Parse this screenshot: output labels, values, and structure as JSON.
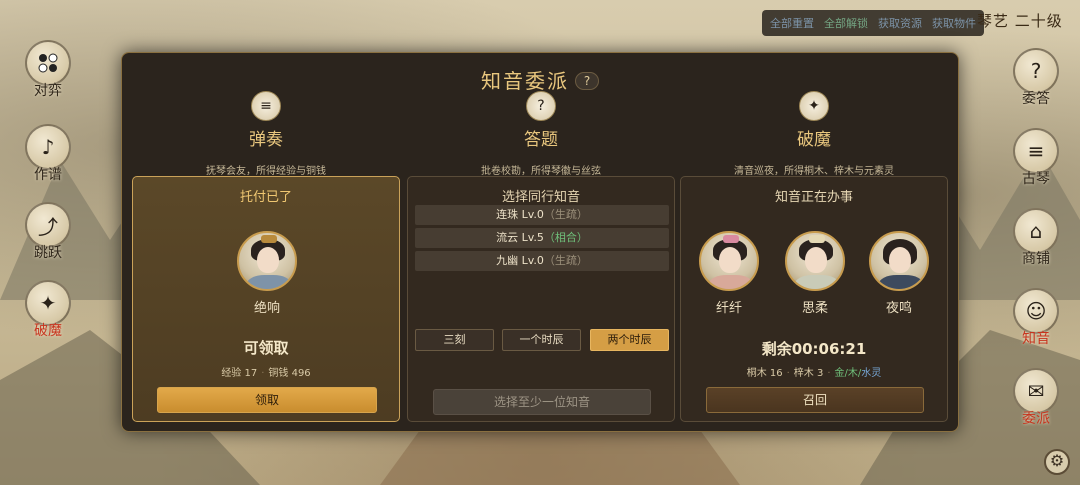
{
  "debug_bar": {
    "reset_all": "全部重置",
    "unlock_all": "全部解锁",
    "get_resources": "获取资源",
    "get_items": "获取物件"
  },
  "skill_level": "琴艺 二十级",
  "left_nav": [
    {
      "label": "对弈",
      "icon": "go-board-icon"
    },
    {
      "label": "作谱",
      "icon": "score-icon"
    },
    {
      "label": "跳跃",
      "icon": "jump-icon"
    },
    {
      "label": "破魔",
      "icon": "exorcise-icon",
      "active": true
    }
  ],
  "right_nav": [
    {
      "label": "委答",
      "icon": "question-scroll-icon"
    },
    {
      "label": "古琴",
      "icon": "guqin-icon"
    },
    {
      "label": "商铺",
      "icon": "shop-icon"
    },
    {
      "label": "知音",
      "icon": "friend-icon"
    },
    {
      "label": "委派",
      "icon": "dispatch-icon"
    }
  ],
  "modal": {
    "title": "知音委派",
    "help": "?",
    "columns": [
      {
        "name": "弹奏",
        "desc": "抚琴会友，所得经验与铜钱",
        "icon": "guqin-icon",
        "panel_title": "托付已了",
        "character": "绝响",
        "status": "可领取",
        "reward_exp": "经验 17",
        "reward_coin": "铜钱 496",
        "button": "领取"
      },
      {
        "name": "答题",
        "desc": "批卷校勘，所得琴徽与丝弦",
        "icon": "question-scroll-icon",
        "panel_title": "选择同行知音",
        "companions": [
          {
            "name": "连珠 Lv.0",
            "relation": "（生疏）",
            "rel_class": "cool"
          },
          {
            "name": "流云 Lv.5",
            "relation": "（相合）",
            "rel_class": "fit"
          },
          {
            "name": "九幽 Lv.0",
            "relation": "（生疏）",
            "rel_class": "cool"
          }
        ],
        "durations": [
          "三刻",
          "一个时辰",
          "两个时辰"
        ],
        "selected_duration": "两个时辰",
        "button": "选择至少一位知音"
      },
      {
        "name": "破魔",
        "desc": "清音巡夜，所得桐木、梓木与元素灵",
        "icon": "exorcise-icon",
        "panel_title": "知音正在办事",
        "characters": [
          "纤纤",
          "思柔",
          "夜鸣"
        ],
        "countdown": "剩余00:06:21",
        "reward_tong": "桐木 16",
        "reward_zi": "梓木 3",
        "reward_elem_metal": "金",
        "reward_elem_wood": "木",
        "reward_elem_water": "水灵",
        "button": "召回"
      }
    ]
  }
}
